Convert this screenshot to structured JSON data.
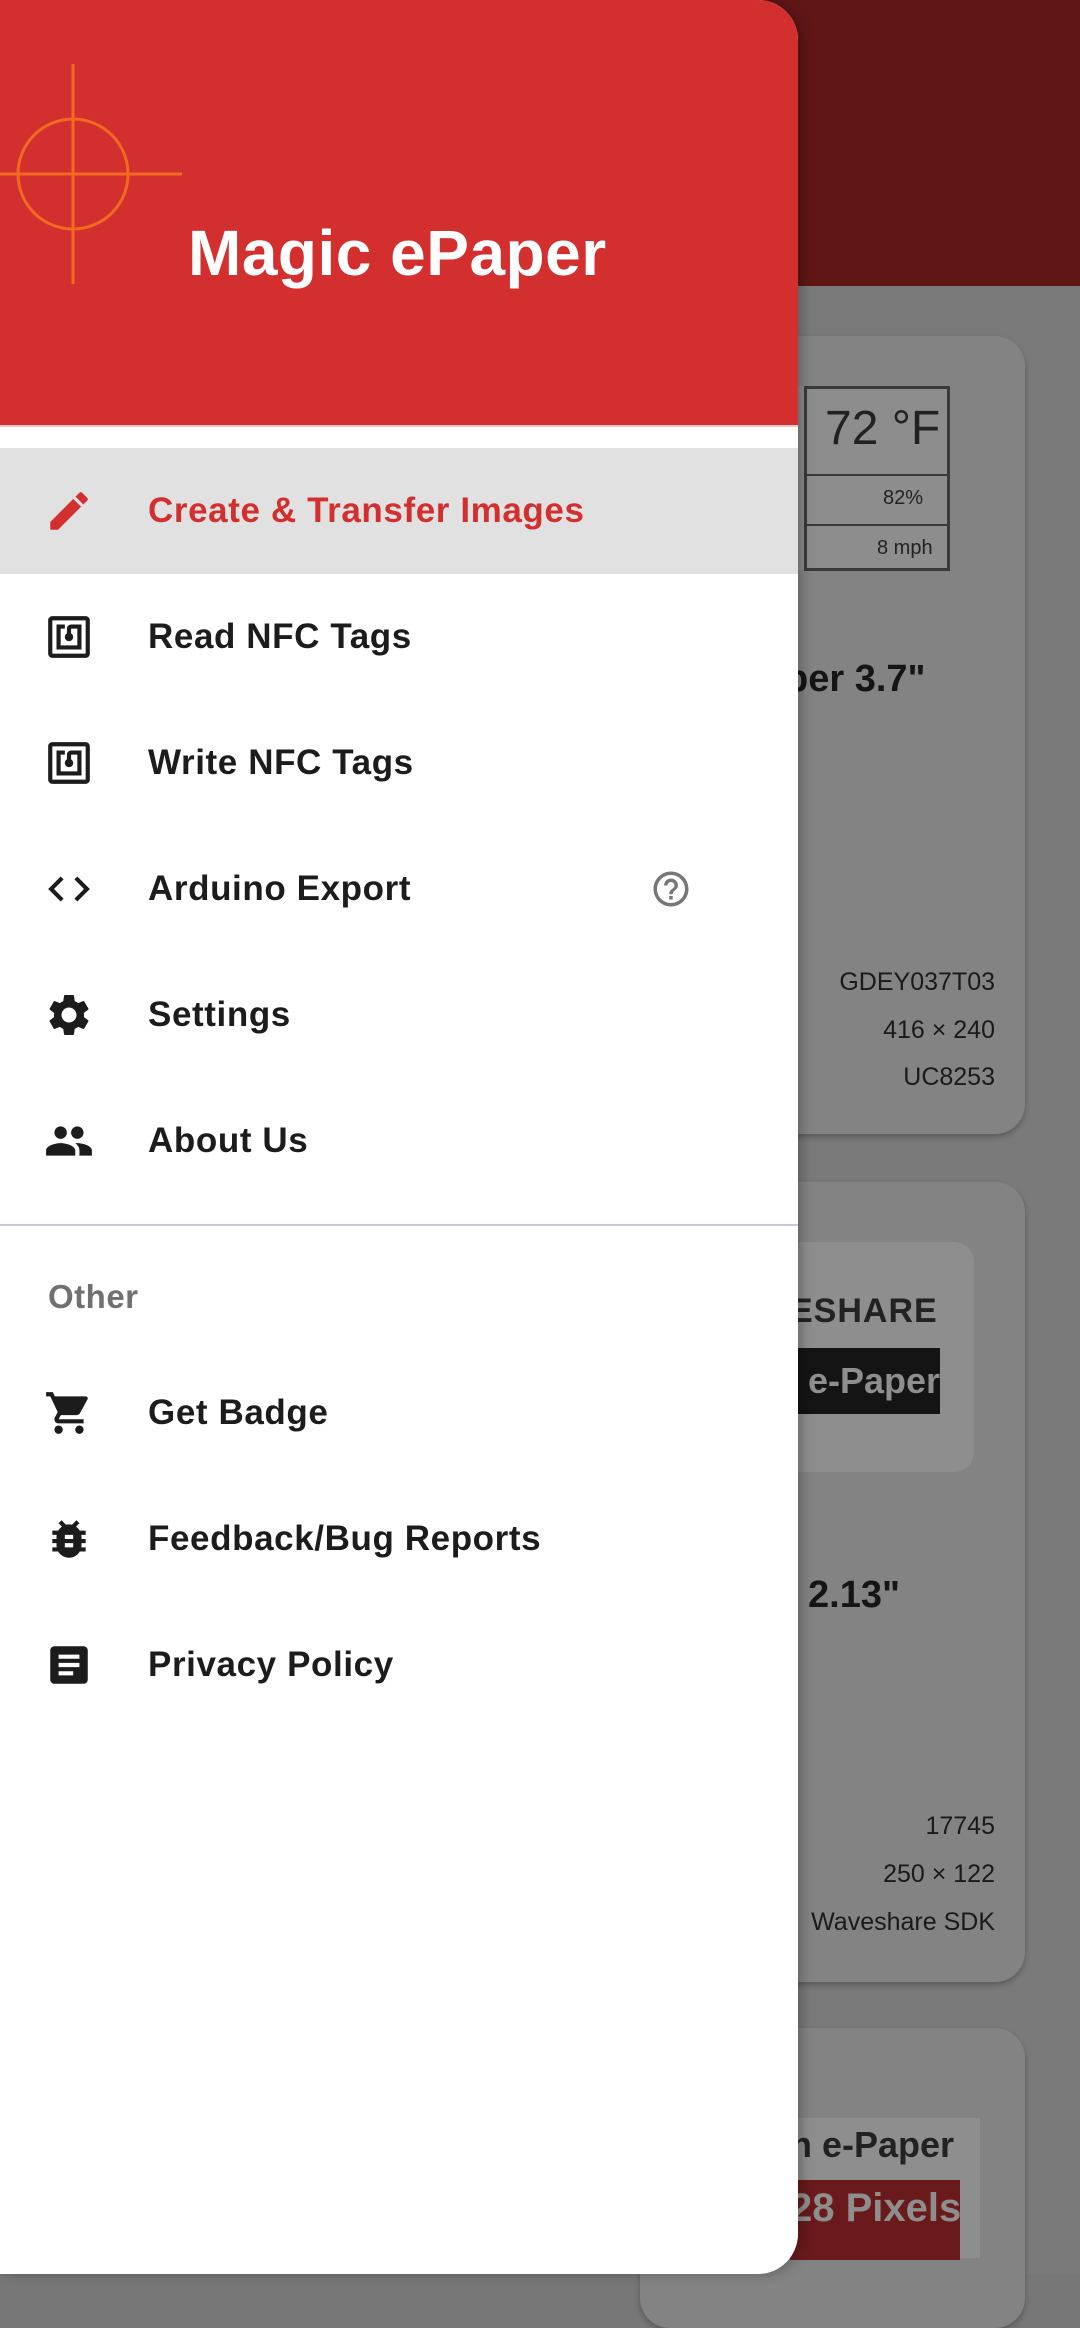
{
  "drawer": {
    "title": "Magic ePaper",
    "items": [
      {
        "label": "Create & Transfer Images",
        "icon": "pencil-icon",
        "selected": true
      },
      {
        "label": "Read NFC Tags",
        "icon": "nfc-icon"
      },
      {
        "label": "Write NFC Tags",
        "icon": "nfc-icon"
      },
      {
        "label": "Arduino Export",
        "icon": "code-icon",
        "help_icon": "help-circle-icon"
      },
      {
        "label": "Settings",
        "icon": "gear-icon"
      },
      {
        "label": "About Us",
        "icon": "people-icon"
      }
    ],
    "section_label": "Other",
    "other_items": [
      {
        "label": "Get Badge",
        "icon": "cart-icon"
      },
      {
        "label": "Feedback/Bug Reports",
        "icon": "bug-icon"
      },
      {
        "label": "Privacy Policy",
        "icon": "document-icon"
      }
    ]
  },
  "background": {
    "card1": {
      "display_temp": "72 °F",
      "display_humidity": "82%",
      "display_wind": "8 mph",
      "title": "per 3.7\"",
      "model": "GDEY037T03",
      "resolution": "416 × 240",
      "driver": "UC8253"
    },
    "card2": {
      "brand": "ESHARE",
      "badge": "e-Paper",
      "title": "2.13\"",
      "model": "17745",
      "resolution": "250 × 122",
      "driver": "Waveshare SDK"
    },
    "card3": {
      "badge": "n e-Paper",
      "pixels": "28 Pixels"
    }
  },
  "colors": {
    "accent": "#d32f2f",
    "appbar_dimmed": "#611616",
    "selected_bg": "#e1e1e1",
    "scrim": "#7a7a7a"
  }
}
